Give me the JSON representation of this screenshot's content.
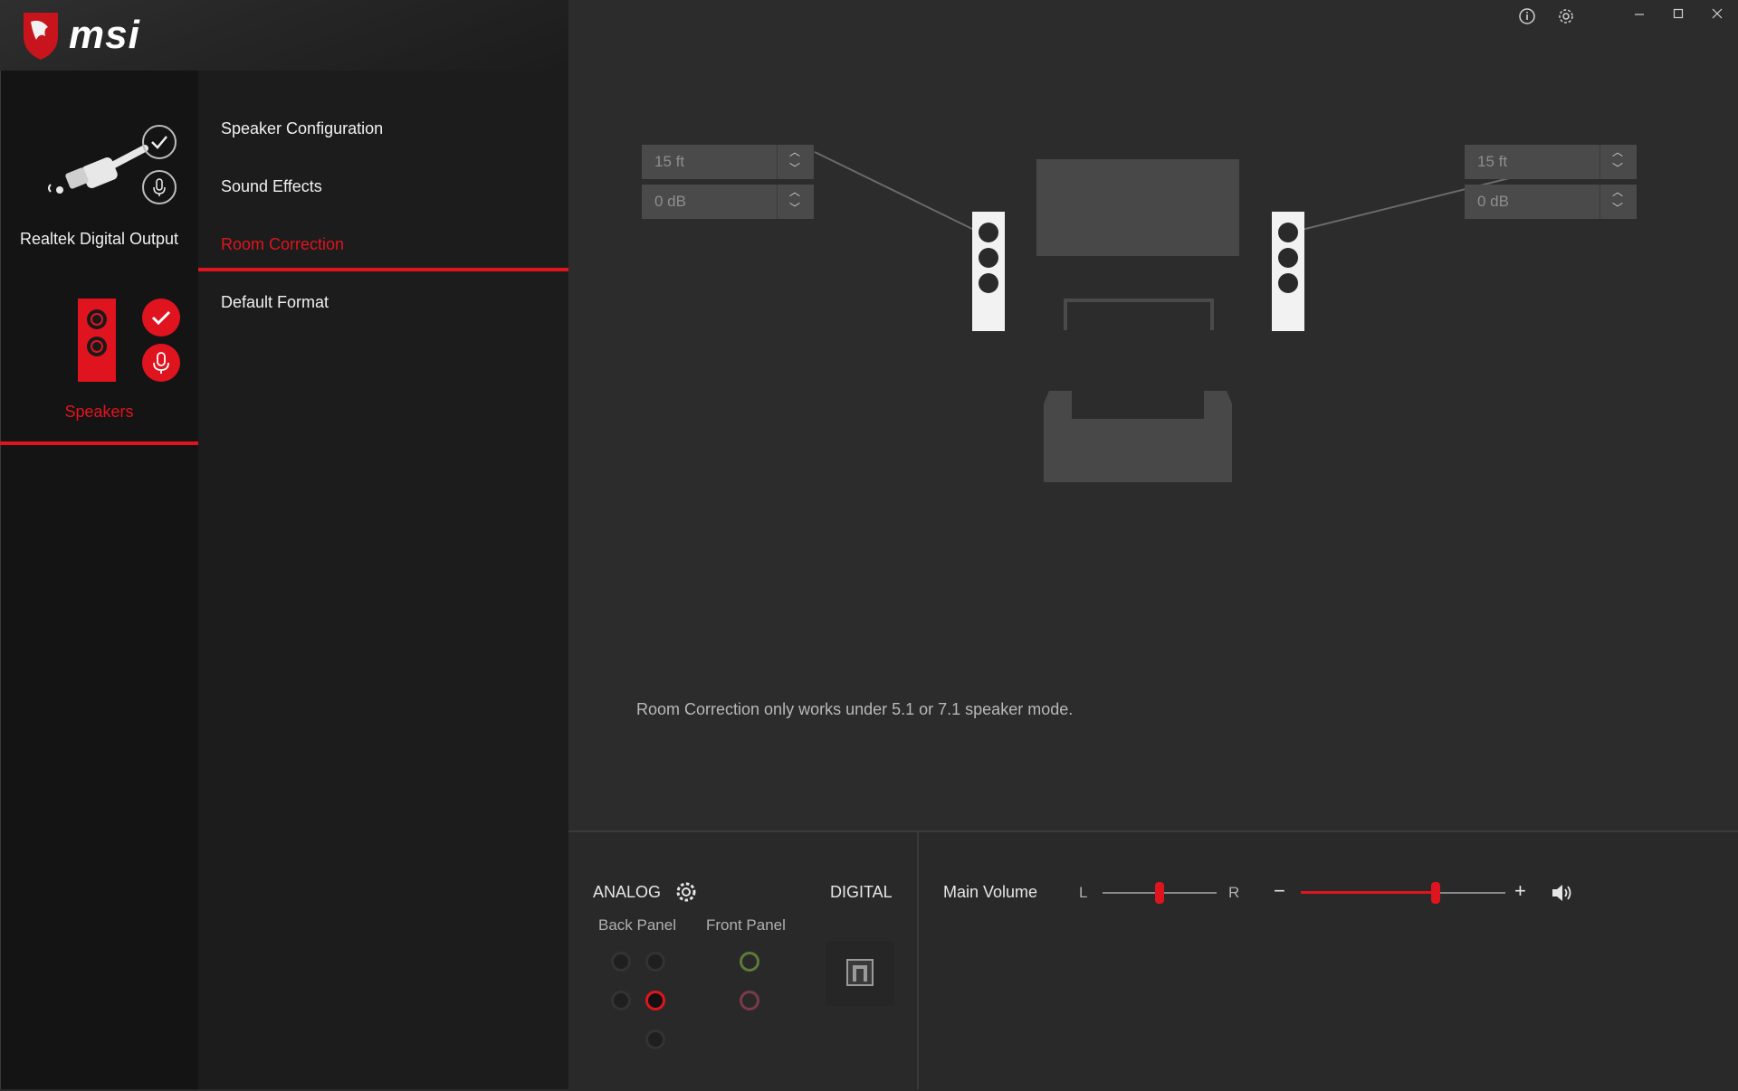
{
  "brand": {
    "logo_text": "msi"
  },
  "devices": [
    {
      "name": "Realtek Digital Output",
      "active": false
    },
    {
      "name": "Speakers",
      "active": true
    }
  ],
  "menu": {
    "items": [
      {
        "label": "Speaker Configuration",
        "active": false
      },
      {
        "label": "Sound Effects",
        "active": false
      },
      {
        "label": "Room Correction",
        "active": true
      },
      {
        "label": "Default Format",
        "active": false
      }
    ]
  },
  "room": {
    "left": {
      "distance": "15 ft",
      "gain": "0 dB"
    },
    "right": {
      "distance": "15 ft",
      "gain": "0 dB"
    },
    "note": "Room Correction only works under 5.1 or 7.1 speaker mode."
  },
  "connectors": {
    "analog_label": "ANALOG",
    "digital_label": "DIGITAL",
    "back_panel_label": "Back Panel",
    "front_panel_label": "Front Panel"
  },
  "volume": {
    "label": "Main Volume",
    "left_label": "L",
    "right_label": "R",
    "minus": "−",
    "plus": "+",
    "balance": 0.5,
    "level": 0.66
  },
  "colors": {
    "accent": "#e0141e"
  }
}
